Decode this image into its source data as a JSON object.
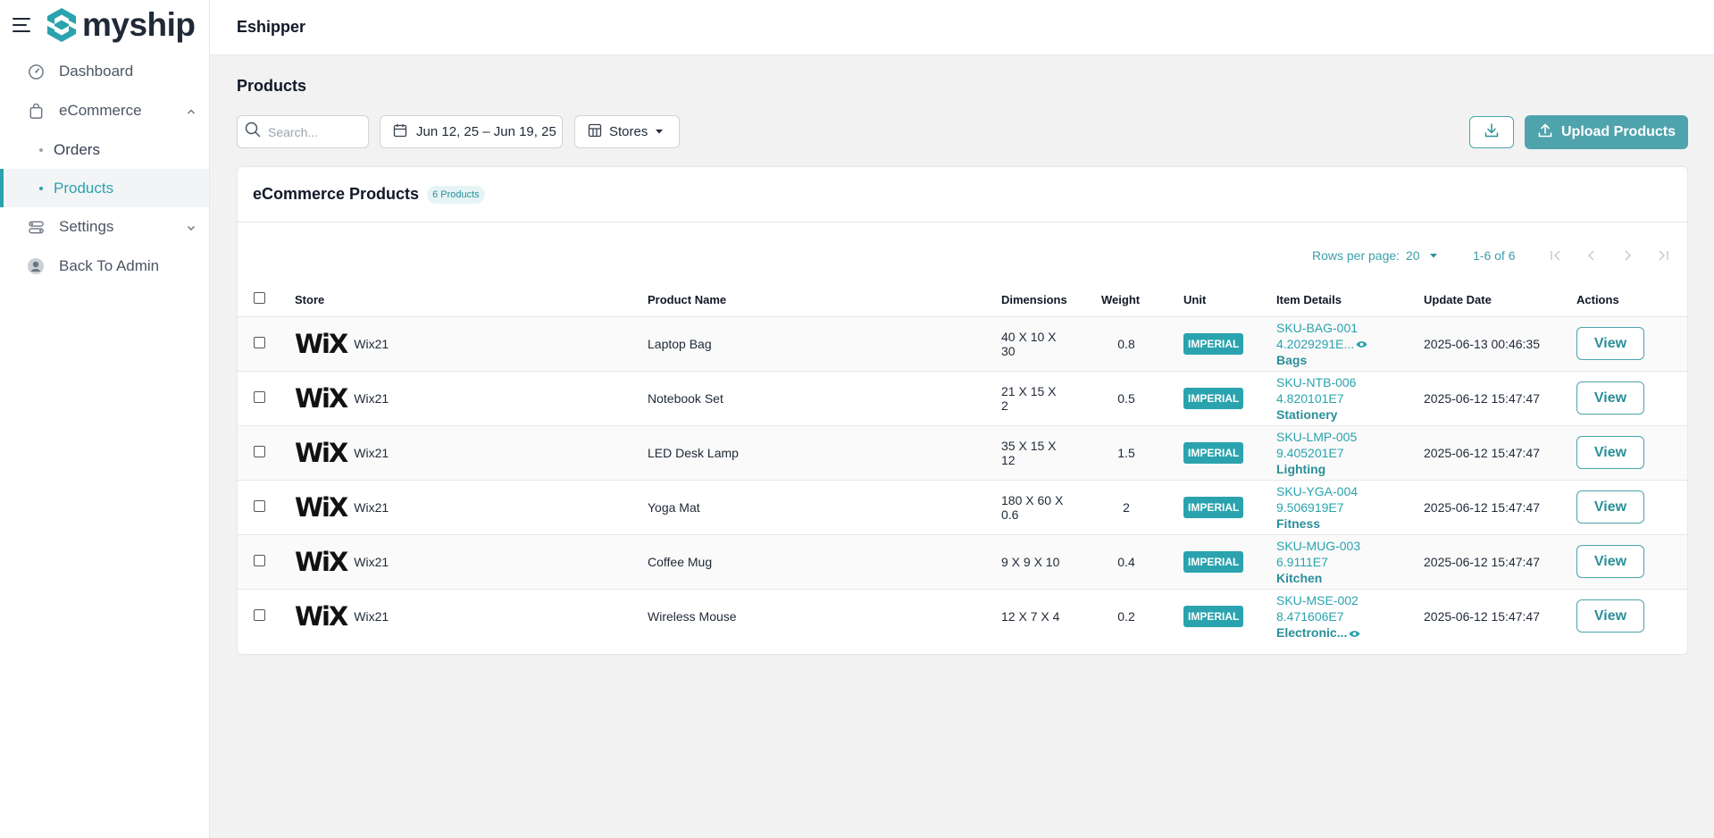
{
  "brand": {
    "name": "myship"
  },
  "header": {
    "title": "Eshipper"
  },
  "sidebar": {
    "items": [
      {
        "label": "Dashboard",
        "icon": "dashboard-gauge-icon"
      },
      {
        "label": "eCommerce",
        "icon": "shopping-bag-icon",
        "expanded": true,
        "children": [
          {
            "label": "Orders"
          },
          {
            "label": "Products",
            "active": true
          }
        ]
      },
      {
        "label": "Settings",
        "icon": "toggles-icon",
        "expanded": false
      },
      {
        "label": "Back To Admin",
        "icon": "user-avatar-icon"
      }
    ]
  },
  "page": {
    "title": "Products"
  },
  "toolbar": {
    "search_placeholder": "Search...",
    "date_range": "Jun 12, 25 – Jun 19, 25",
    "stores_label": "Stores",
    "upload_label": "Upload Products"
  },
  "card": {
    "title": "eCommerce Products",
    "count_badge": "6 Products"
  },
  "pagination": {
    "rows_per_page_label": "Rows per page:",
    "rows_per_page": "20",
    "range": "1-6 of 6"
  },
  "table": {
    "columns": [
      "Store",
      "Product Name",
      "Dimensions",
      "Weight",
      "Unit",
      "Item Details",
      "Update Date",
      "Actions"
    ],
    "rows": [
      {
        "store_logo": "WiX",
        "store": "Wix21",
        "product": "Laptop Bag",
        "dimensions": "40 X 10 X 30",
        "weight": "0.8",
        "unit": "IMPERIAL",
        "sku": "SKU-BAG-001",
        "num": "4.2029291E...",
        "cat": "Bags",
        "updated": "2025-06-13 00:46:35",
        "action": "View"
      },
      {
        "store_logo": "WiX",
        "store": "Wix21",
        "product": "Notebook Set",
        "dimensions": "21 X 15 X 2",
        "weight": "0.5",
        "unit": "IMPERIAL",
        "sku": "SKU-NTB-006",
        "num": "4.820101E7",
        "cat": "Stationery",
        "updated": "2025-06-12 15:47:47",
        "action": "View"
      },
      {
        "store_logo": "WiX",
        "store": "Wix21",
        "product": "LED Desk Lamp",
        "dimensions": "35 X 15 X 12",
        "weight": "1.5",
        "unit": "IMPERIAL",
        "sku": "SKU-LMP-005",
        "num": "9.405201E7",
        "cat": "Lighting",
        "updated": "2025-06-12 15:47:47",
        "action": "View"
      },
      {
        "store_logo": "WiX",
        "store": "Wix21",
        "product": "Yoga Mat",
        "dimensions": "180 X 60 X 0.6",
        "weight": "2",
        "unit": "IMPERIAL",
        "sku": "SKU-YGA-004",
        "num": "9.506919E7",
        "cat": "Fitness",
        "updated": "2025-06-12 15:47:47",
        "action": "View"
      },
      {
        "store_logo": "WiX",
        "store": "Wix21",
        "product": "Coffee Mug",
        "dimensions": "9 X 9 X 10",
        "weight": "0.4",
        "unit": "IMPERIAL",
        "sku": "SKU-MUG-003",
        "num": "6.9111E7",
        "cat": "Kitchen",
        "updated": "2025-06-12 15:47:47",
        "action": "View"
      },
      {
        "store_logo": "WiX",
        "store": "Wix21",
        "product": "Wireless Mouse",
        "dimensions": "12 X 7 X 4",
        "weight": "0.2",
        "unit": "IMPERIAL",
        "sku": "SKU-MSE-002",
        "num": "8.471606E7",
        "cat": "Electronic...",
        "updated": "2025-06-12 15:47:47",
        "action": "View"
      }
    ]
  },
  "colors": {
    "accent": "#2aa3ae",
    "accent_dark": "#2a8f99",
    "upload_button": "#4fa3ad",
    "background": "#f2f2f3"
  }
}
